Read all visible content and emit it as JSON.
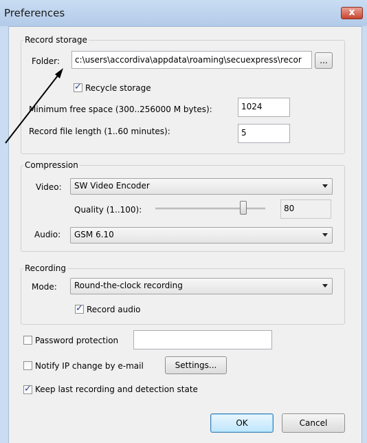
{
  "window": {
    "title": "Preferences",
    "close_label": "x"
  },
  "record_storage": {
    "group_label": "Record storage",
    "folder_label": "Folder:",
    "folder_value": "c:\\users\\accordiva\\appdata\\roaming\\secuexpress\\recor",
    "browse_label": "...",
    "recycle_label": "Recycle storage",
    "recycle_checked": true,
    "min_free_label": "Minimum free space (300..256000 M bytes):",
    "min_free_value": "1024",
    "file_length_label": "Record file length (1..60 minutes):",
    "file_length_value": "5"
  },
  "compression": {
    "group_label": "Compression",
    "video_label": "Video:",
    "video_value": "SW Video Encoder",
    "quality_label": "Quality (1..100):",
    "quality_value": "80",
    "quality_level": 80,
    "audio_label": "Audio:",
    "audio_value": "GSM 6.10"
  },
  "recording": {
    "group_label": "Recording",
    "mode_label": "Mode:",
    "mode_value": "Round-the-clock recording",
    "record_audio_label": "Record audio",
    "record_audio_checked": true
  },
  "options": {
    "password_label": "Password protection",
    "password_checked": false,
    "password_value": "",
    "notify_label": "Notify IP change by e-mail",
    "notify_checked": false,
    "settings_label": "Settings...",
    "keep_label": "Keep last recording and detection state",
    "keep_checked": true
  },
  "buttons": {
    "ok_label": "OK",
    "cancel_label": "Cancel"
  }
}
